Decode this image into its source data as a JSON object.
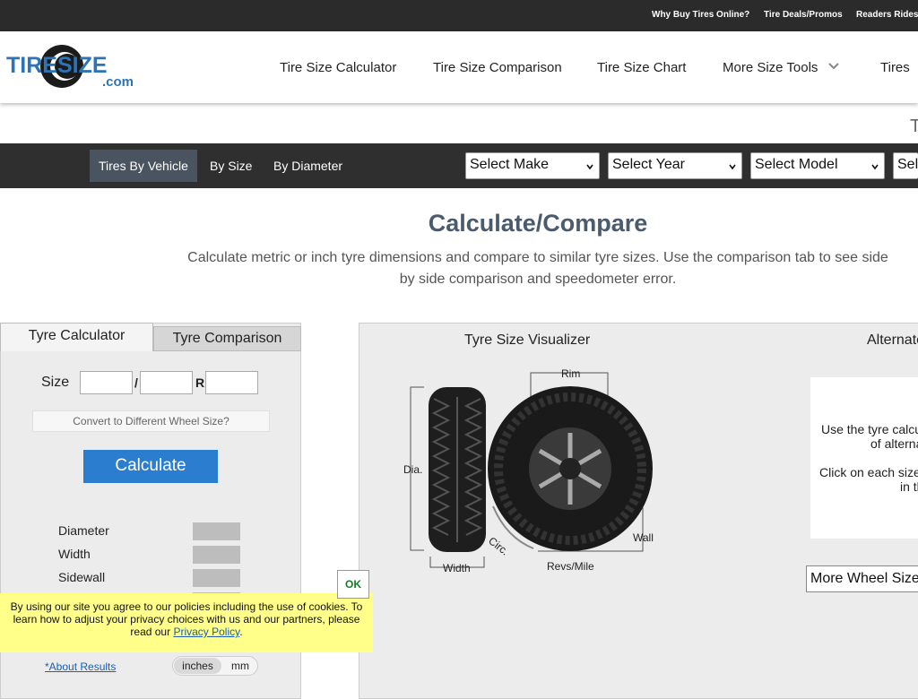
{
  "topbar": {
    "links": [
      "Why Buy Tires Online?",
      "Tire Deals/Promos",
      "Readers Rides"
    ]
  },
  "header": {
    "logo_text_main": "TIRESIZE",
    "logo_text_sub": ".com",
    "nav": [
      "Tire Size Calculator",
      "Tire Size Comparison",
      "Tire Size Chart",
      "More Size Tools",
      "Tires"
    ]
  },
  "page_partial_letter": "T",
  "vehicle_bar": {
    "tabs": [
      "Tires By Vehicle",
      "By Size",
      "By Diameter"
    ],
    "active_tab": 0,
    "selects": [
      "Select Make",
      "Select Year",
      "Select Model",
      "Sele"
    ]
  },
  "main": {
    "title": "Calculate/Compare",
    "subtitle": "Calculate metric or inch tyre dimensions and compare to similar tyre sizes. Use the comparison tab to see side by side comparison and speedometer error."
  },
  "calculator": {
    "tabs": [
      "Tyre Calculator",
      "Tyre Comparison"
    ],
    "size_label": "Size",
    "sep_slash": "/",
    "sep_r": "R",
    "convert_label": "Convert to Different Wheel Size?",
    "calculate_label": "Calculate",
    "results": [
      "Diameter",
      "Width",
      "Sidewall"
    ],
    "about_label": "*About Results",
    "units": [
      "inches",
      "mm"
    ]
  },
  "cookie": {
    "text": "By using our site you agree to our policies including the use of cookies. To learn how to adjust your privacy choices with us and our partners, please read our",
    "link": "Privacy Policy",
    "end": ".",
    "ok_label": "OK"
  },
  "visualizer": {
    "title": "Tyre Size Visualizer",
    "labels": {
      "rim": "Rim",
      "dia": "Dia.",
      "circ": "Circ.",
      "wall": "Wall",
      "width": "Width",
      "revs": "Revs/Mile"
    }
  },
  "alternates": {
    "title": "Alternate",
    "line1": "Use the tyre calcu",
    "line2": "of alterna",
    "line3": "Click on each size",
    "line4": "in th",
    "more_wheel": "More Wheel Size"
  },
  "colors": {
    "accent": "#2b7dd0",
    "title": "#4b5b6e",
    "cookie_bg": "#ffff8a"
  }
}
